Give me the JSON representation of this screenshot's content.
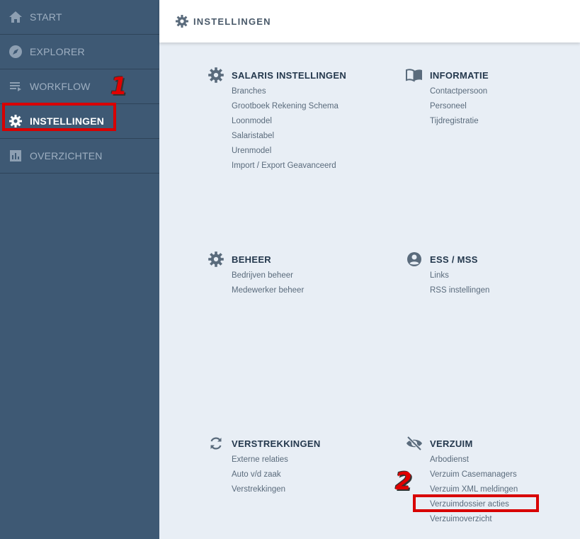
{
  "sidebar": {
    "items": [
      {
        "label": "START",
        "icon": "home-icon"
      },
      {
        "label": "EXPLORER",
        "icon": "compass-icon"
      },
      {
        "label": "WORKFLOW",
        "icon": "list-icon"
      },
      {
        "label": "INSTELLINGEN",
        "icon": "gear-icon"
      },
      {
        "label": "OVERZICHTEN",
        "icon": "bar-chart-icon"
      }
    ]
  },
  "markers": {
    "one": "1",
    "two": "2"
  },
  "header": {
    "title": "INSTELLINGEN"
  },
  "sections": {
    "salaris": {
      "title": "SALARIS INSTELLINGEN",
      "items": [
        "Branches",
        "Grootboek Rekening Schema",
        "Loonmodel",
        "Salaristabel",
        "Urenmodel",
        "Import / Export Geavanceerd"
      ]
    },
    "informatie": {
      "title": "INFORMATIE",
      "items": [
        "Contactpersoon",
        "Personeel",
        "Tijdregistratie"
      ]
    },
    "beheer": {
      "title": "BEHEER",
      "items": [
        "Bedrijven beheer",
        "Medewerker beheer"
      ]
    },
    "ess": {
      "title": "ESS / MSS",
      "items": [
        "Links",
        "RSS instellingen"
      ]
    },
    "verstrekkingen": {
      "title": "VERSTREKKINGEN",
      "items": [
        "Externe relaties",
        "Auto v/d zaak",
        "Verstrekkingen"
      ]
    },
    "verzuim": {
      "title": "VERZUIM",
      "items": [
        "Arbodienst",
        "Verzuim Casemanagers",
        "Verzuim XML meldingen",
        "Verzuimdossier acties",
        "Verzuimoverzicht"
      ]
    }
  },
  "colors": {
    "sidebar": "#3e5974",
    "content": "#e8eef5",
    "highlight": "#d80000"
  }
}
